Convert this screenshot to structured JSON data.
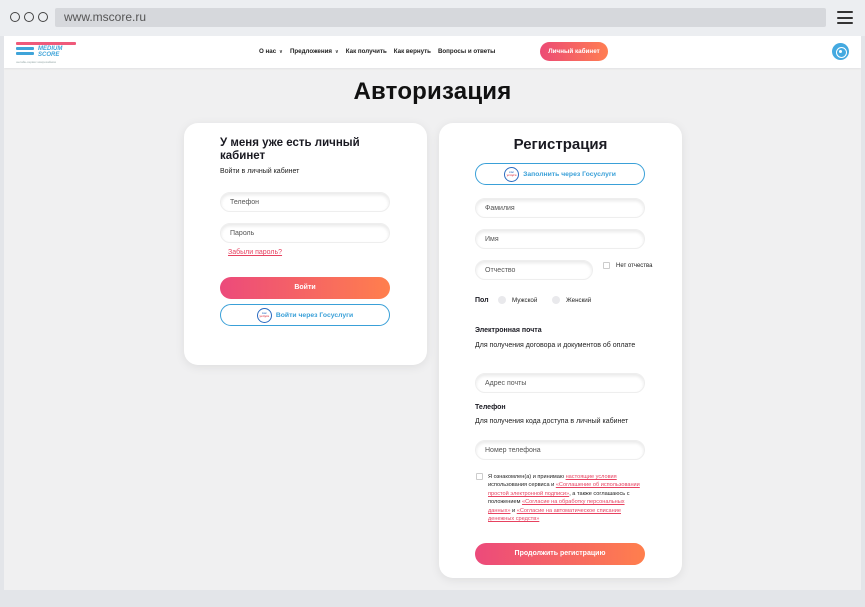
{
  "browser": {
    "url": "www.mscore.ru"
  },
  "header": {
    "logo_line1": "MEDIUM",
    "logo_line2": "SCORE",
    "logo_tagline": "онлайн-сервис микрозаймов",
    "nav": [
      {
        "label": "О нас",
        "dropdown": true
      },
      {
        "label": "Предложения",
        "dropdown": true
      },
      {
        "label": "Как получить",
        "dropdown": false
      },
      {
        "label": "Как вернуть",
        "dropdown": false
      },
      {
        "label": "Вопросы и ответы",
        "dropdown": false
      }
    ],
    "cabinet_button": "Личный кабинет",
    "chevron_glyph": "∨"
  },
  "page": {
    "title": "Авторизация"
  },
  "login": {
    "title": "У меня уже есть личный кабинет",
    "subtitle": "Войти в личный кабинет",
    "phone_placeholder": "Телефон",
    "password_placeholder": "Пароль",
    "forgot_link": "Забыли пароль?",
    "submit_button": "Войти",
    "gosuslugi_button": "Войти через Госуслуги"
  },
  "gos_logo": {
    "top": "гос",
    "bottom": "услуги"
  },
  "register": {
    "title": "Регистрация",
    "gosuslugi_button": "Заполнить через Госуслуги",
    "lastname_placeholder": "Фамилия",
    "firstname_placeholder": "Имя",
    "middlename_placeholder": "Отчество",
    "no_middlename_label": "Нет отчества",
    "gender_label": "Пол",
    "gender_male": "Мужской",
    "gender_female": "Женский",
    "email_heading": "Электронная почта",
    "email_hint": "Для получения договора и документов об оплате",
    "email_placeholder": "Адрес почты",
    "phone_heading": "Телефон",
    "phone_hint": "Для получения кода доступа в личный кабинет",
    "phone_placeholder": "Номер телефона",
    "consent": {
      "text1": "Я ознакомлен(а) и принимаю ",
      "link1": "настоящие условия",
      "text2": " использования сервиса и ",
      "link2": "«Соглашение об использовании простой электронной подписи»",
      "text3": ", а также соглашаюсь с положением ",
      "link3": "«Согласие на обработку персональных данных»",
      "text4": " и ",
      "link4": "«Согласие на автоматическое списание денежных средств»"
    },
    "submit_button": "Продолжить регистрацию"
  },
  "colors": {
    "accent_gradient_start": "#ec4a7b",
    "accent_gradient_end": "#ff7f4d",
    "gosuslugi_blue": "#3aa0d8",
    "link_red": "#e74260"
  }
}
